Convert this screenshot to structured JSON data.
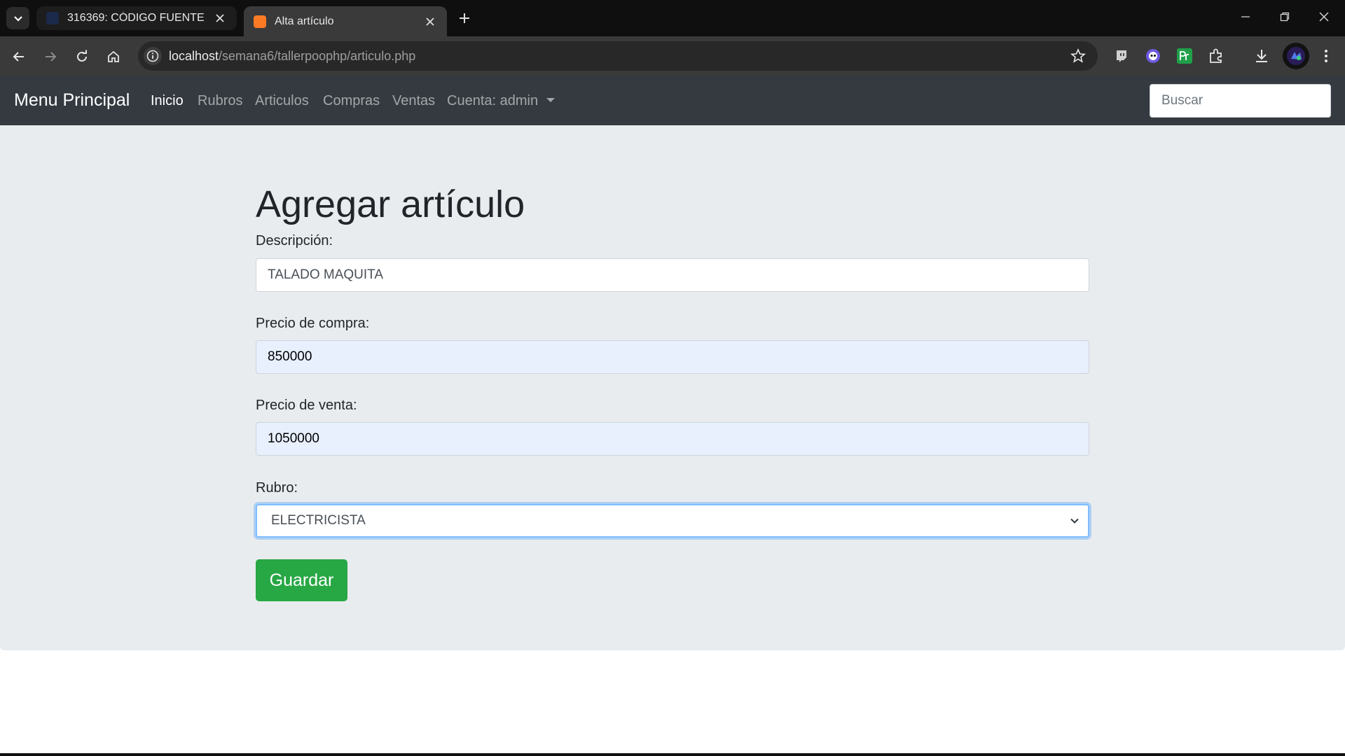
{
  "browser": {
    "tabs": [
      {
        "title": "316369: CÓDIGO FUENTE",
        "active": false
      },
      {
        "title": "Alta artículo",
        "active": true
      }
    ],
    "url_host": "localhost",
    "url_path": "/semana6/tallerpoophp/articulo.php",
    "icons": [
      "tab-search-icon",
      "close-icon",
      "new-tab-icon",
      "minimize-icon",
      "restore-icon",
      "back-icon",
      "forward-icon",
      "reload-icon",
      "home-icon",
      "info-icon",
      "star-icon",
      "download-icon",
      "menu-icon"
    ]
  },
  "navbar": {
    "brand": "Menu Principal",
    "links": [
      "Inicio",
      "Rubros",
      "Articulos",
      "Compras",
      "Ventas"
    ],
    "account": "Cuenta: admin",
    "search_placeholder": "Buscar"
  },
  "form": {
    "title": "Agregar artículo",
    "descripcion_label": "Descripción:",
    "descripcion_value": "TALADO MAQUITA",
    "precio_compra_label": "Precio de compra:",
    "precio_compra_value": "850000",
    "precio_venta_label": "Precio de venta:",
    "precio_venta_value": "1050000",
    "rubro_label": "Rubro:",
    "rubro_value": "ELECTRICISTA",
    "save_label": "Guardar"
  },
  "colors": {
    "navbar_bg": "#343a40",
    "jumbotron_bg": "#e9ecef",
    "save_button": "#28a745",
    "autofill_bg": "#e8f0fe",
    "focus_border": "#80bdff"
  }
}
